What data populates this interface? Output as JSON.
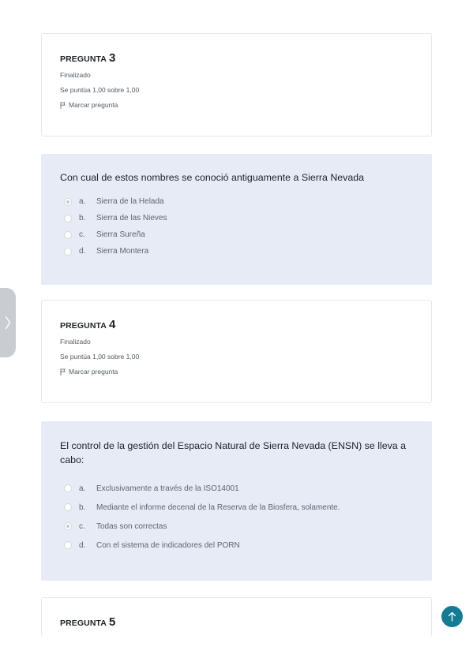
{
  "questions": [
    {
      "label": "PREGUNTA",
      "number": "3",
      "status": "Finalizado",
      "score": "Se puntúa 1,00 sobre 1,00",
      "flag_label": "Marcar pregunta",
      "text": "Con cual de estos nombres se conoció antiguamente a Sierra Nevada",
      "answers": [
        {
          "letter": "a.",
          "text": "Sierra de la Helada",
          "selected": true
        },
        {
          "letter": "b.",
          "text": "Sierra de las Nieves",
          "selected": false
        },
        {
          "letter": "c.",
          "text": "Sierra Sureña",
          "selected": false
        },
        {
          "letter": "d.",
          "text": "Sierra Montera",
          "selected": false
        }
      ]
    },
    {
      "label": "PREGUNTA",
      "number": "4",
      "status": "Finalizado",
      "score": "Se puntúa 1,00 sobre 1,00",
      "flag_label": "Marcar pregunta",
      "text": "El control de la gestión del Espacio Natural de Sierra Nevada (ENSN) se lleva a cabo:",
      "answers": [
        {
          "letter": "a.",
          "text": "Exclusivamente a través de la ISO14001",
          "selected": false
        },
        {
          "letter": "b.",
          "text": "Mediante el informe decenal de la Reserva de la Biosfera, solamente.",
          "selected": false
        },
        {
          "letter": "c.",
          "text": "Todas son correctas",
          "selected": true
        },
        {
          "letter": "d.",
          "text": "Con el sistema de indicadores del PORN",
          "selected": false
        }
      ]
    },
    {
      "label": "PREGUNTA",
      "number": "5"
    }
  ],
  "icons": {
    "flag": "flag-icon",
    "drawer": "chevron-right-icon",
    "back_to_top": "arrow-up-icon"
  },
  "colors": {
    "accent": "#137b93",
    "content_bg": "#e7ebf6",
    "card_border": "#e6e8ea"
  }
}
